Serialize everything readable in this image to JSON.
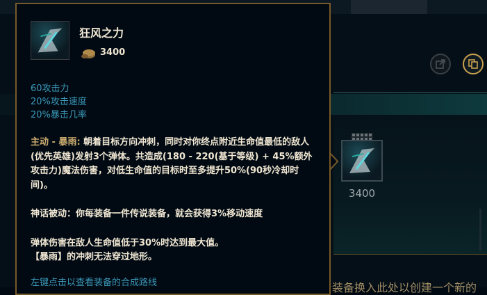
{
  "background": {
    "slot_price": "3400",
    "partial_text": "装备换入此处以创建一个新的"
  },
  "tooltip": {
    "item_name": "狂风之力",
    "cost": "3400",
    "stats": [
      "60攻击力",
      "20%攻击速度",
      "20%暴击几率"
    ],
    "active_label": "主动 - 暴雨:",
    "active_text": " 朝着目标方向冲刺，同时对你终点附近生命值最低的敌人(优先英雄)发射3个弹体。共造成(180 - 220(基于等级) + 45%额外攻击力)魔法伤害，对低生命值的目标时至多提升50%(90秒冷却时间)。",
    "passive_text": "神话被动：你每装备一件传说装备，就会获得3%移动速度",
    "note1": "弹体伤害在敌人生命值低于30%时达到最大值。",
    "note2": "【暴雨】的冲刺无法穿过地形。",
    "footer_hint": "左键点击以查看装备的合成路线"
  },
  "icons": {
    "share": "share-icon",
    "copy": "copy-icon",
    "gold": "gold-coin-icon",
    "item": "stormrazor-item-icon"
  },
  "colors": {
    "gold_border": "#785a28",
    "stat_blue": "#3b98b8",
    "text_light": "#f0e6d2",
    "active_gold": "#c8aa6e"
  }
}
